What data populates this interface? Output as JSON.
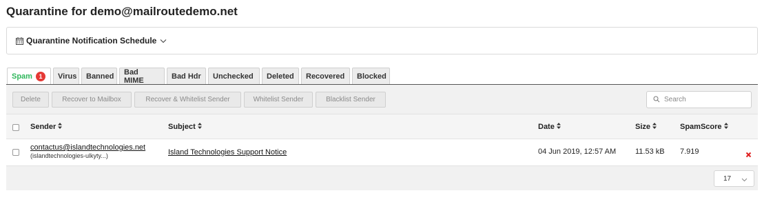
{
  "page": {
    "title": "Quarantine for demo@mailroutedemo.net"
  },
  "schedule": {
    "label": "Quarantine Notification Schedule"
  },
  "tabs": [
    {
      "label": "Spam",
      "badge": "1",
      "active": true
    },
    {
      "label": "Virus"
    },
    {
      "label": "Banned"
    },
    {
      "label": "Bad MIME"
    },
    {
      "label": "Bad Hdr"
    },
    {
      "label": "Unchecked"
    },
    {
      "label": "Deleted"
    },
    {
      "label": "Recovered"
    },
    {
      "label": "Blocked"
    }
  ],
  "toolbar": {
    "delete": "Delete",
    "recover": "Recover to Mailbox",
    "recover_whitelist": "Recover & Whitelist Sender",
    "whitelist": "Whitelist Sender",
    "blacklist": "Blacklist Sender",
    "search_placeholder": "Search"
  },
  "table": {
    "columns": [
      "Sender",
      "Subject",
      "Date",
      "Size",
      "SpamScore"
    ],
    "rows": [
      {
        "sender_email": "contactus@islandtechnologies.net",
        "sender_name": "(islandtechnologies-ulkyty...)",
        "subject": "Island Technologies Support Notice",
        "date": "04 Jun 2019, 12:57 AM",
        "size": "11.53 kB",
        "spam_score": "7.919"
      }
    ]
  },
  "pager": {
    "page_size": "17"
  },
  "colors": {
    "active_tab": "#2fb75b",
    "badge": "#e53935",
    "delete_icon": "#e02020"
  }
}
